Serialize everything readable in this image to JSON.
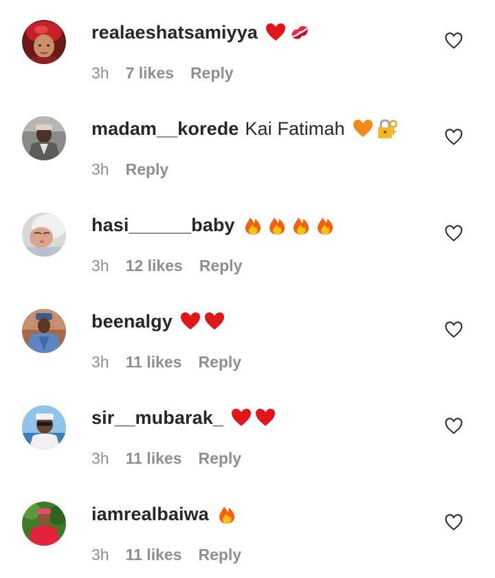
{
  "comments": [
    {
      "username": "realaeshatsamiyya",
      "text": "",
      "emojis": [
        "red-heart",
        "kiss-mark"
      ],
      "time": "3h",
      "likes": "7 likes",
      "reply": "Reply",
      "avatar": "avatar-woman-red-headwrap"
    },
    {
      "username": "madam__korede",
      "text": "Kai Fatimah",
      "emojis": [
        "orange-heart",
        "locked-with-key"
      ],
      "time": "3h",
      "likes": "",
      "reply": "Reply",
      "avatar": "avatar-man-grey-attire"
    },
    {
      "username": "hasi______baby",
      "text": "",
      "emojis": [
        "fire",
        "fire",
        "fire",
        "fire"
      ],
      "time": "3h",
      "likes": "12 likes",
      "reply": "Reply",
      "avatar": "avatar-sleeping-baby"
    },
    {
      "username": "beenalgy",
      "text": "",
      "emojis": [
        "red-heart",
        "red-heart"
      ],
      "time": "3h",
      "likes": "11 likes",
      "reply": "Reply",
      "avatar": "avatar-man-blue-robe"
    },
    {
      "username": "sir__mubarak_",
      "text": "",
      "emojis": [
        "red-heart",
        "red-heart"
      ],
      "time": "3h",
      "likes": "11 likes",
      "reply": "Reply",
      "avatar": "avatar-man-sunglasses"
    },
    {
      "username": "iamrealbaiwa",
      "text": "",
      "emojis": [
        "fire"
      ],
      "time": "3h",
      "likes": "11 likes",
      "reply": "Reply",
      "avatar": "avatar-person-red-outfit"
    }
  ],
  "colors": {
    "text": "#262626",
    "secondary": "#8e8e8e",
    "heart_outline": "#262626"
  }
}
